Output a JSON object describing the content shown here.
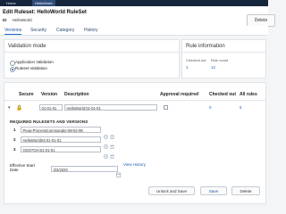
{
  "top_nav": {
    "tab1": "Home",
    "tab2": "HelloWorld"
  },
  "header": {
    "title": "Edit  Ruleset: HelloWorld RuleSet",
    "id_label": "ID",
    "id_value": "HelloWorld",
    "delete_label": "Delete"
  },
  "tabs": [
    "Versions",
    "Security",
    "Category",
    "History"
  ],
  "validation": {
    "title": "Validation mode",
    "options": [
      "Application Validation",
      "Ruleset Validation"
    ],
    "selected_index": 1
  },
  "rule_info": {
    "title": "Rule information",
    "checked_out_label": "Checked out",
    "checked_out_value": "1",
    "rule_count_label": "Rule count",
    "rule_count_value": "12"
  },
  "versions_table": {
    "headers": [
      "Secure",
      "Version",
      "Description",
      "Approval required",
      "Checked out",
      "All rules"
    ],
    "row": {
      "version": "01-01-01",
      "description": "HelloWorld:01-01-01",
      "checked_out": "0",
      "all_rules": "6"
    }
  },
  "required": {
    "title": "REQUIRED RULESETS AND VERSIONS",
    "rows": [
      {
        "num": "1",
        "value": "Pega-ProcessCommander:08-02-99"
      },
      {
        "num": "2",
        "value": "HelloWorldInt:01-01-01"
      },
      {
        "num": "3",
        "value": "OOSTGH:01-01-01"
      }
    ]
  },
  "effective": {
    "label_line1": "Effective Start",
    "label_line2": "Date",
    "value": "3/3/2020",
    "view_history": "View History"
  },
  "buttons": {
    "unlock": "Unlock and Save",
    "save": "Save",
    "delete": "Delete"
  },
  "colors": {
    "nav_bg": "#15253b",
    "link": "#1a5fb4",
    "accent": "#1a69c4"
  }
}
